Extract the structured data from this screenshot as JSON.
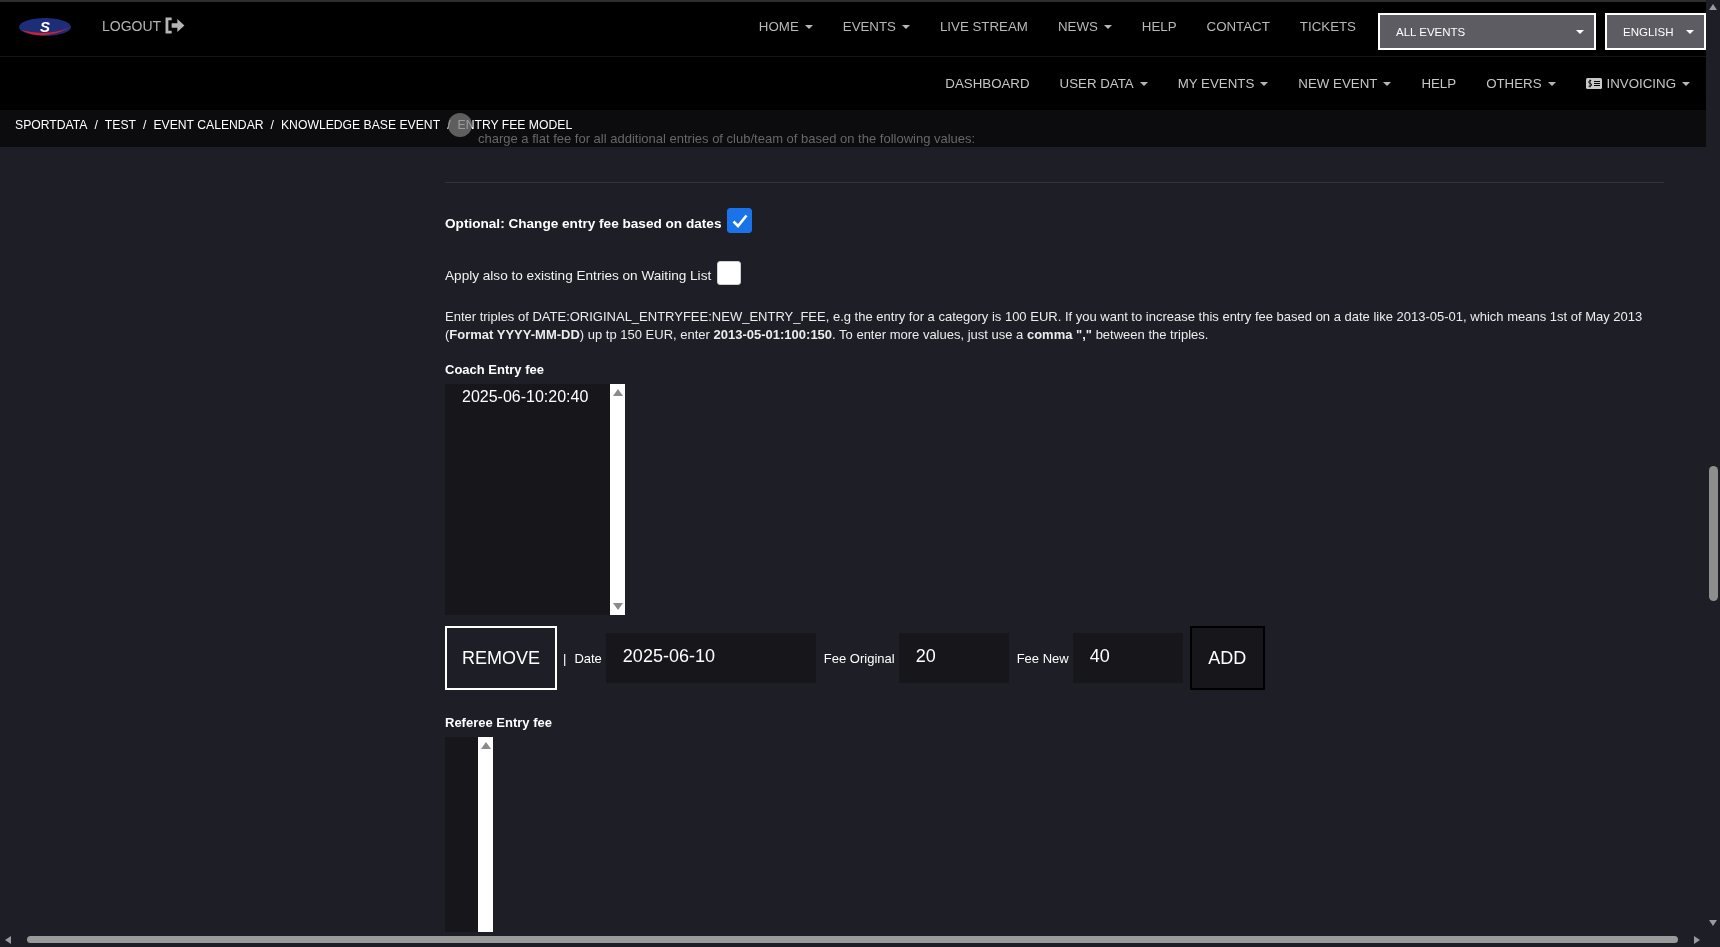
{
  "header": {
    "logo_text": "S",
    "logout": "LOGOUT",
    "main_nav": [
      {
        "label": "HOME",
        "dropdown": true
      },
      {
        "label": "EVENTS",
        "dropdown": true
      },
      {
        "label": "LIVE STREAM",
        "dropdown": false
      },
      {
        "label": "NEWS",
        "dropdown": true
      },
      {
        "label": "HELP",
        "dropdown": false
      },
      {
        "label": "CONTACT",
        "dropdown": false
      },
      {
        "label": "TICKETS",
        "dropdown": false
      }
    ],
    "event_select": {
      "value": "ALL EVENTS"
    },
    "language_select": {
      "value": "ENGLISH"
    }
  },
  "sub_nav": [
    {
      "label": "DASHBOARD",
      "kind": "text",
      "dropdown": false
    },
    {
      "label": "USER DATA",
      "kind": "text",
      "dropdown": true
    },
    {
      "label": "MY EVENTS",
      "kind": "text",
      "dropdown": true
    },
    {
      "label": "NEW EVENT",
      "kind": "text",
      "dropdown": true
    },
    {
      "label": "HELP",
      "kind": "text",
      "dropdown": false
    },
    {
      "label": "OTHERS",
      "kind": "text",
      "dropdown": true
    },
    {
      "label": "INVOICING",
      "kind": "icon_text",
      "dropdown": true
    }
  ],
  "breadcrumb": [
    {
      "label": "SPORTDATA",
      "separator": "/"
    },
    {
      "label": "TEST",
      "separator": "/"
    },
    {
      "label": "EVENT CALENDAR",
      "separator": "/"
    },
    {
      "label": "KNOWLEDGE BASE EVENT",
      "separator": "/"
    },
    {
      "label": "ENTRY FEE MODEL"
    }
  ],
  "hidden_text": "charge a flat fee for all additional entries of club/team of based on the following values:",
  "form": {
    "date_option": {
      "label": "Optional: Change entry fee based on dates",
      "checked": true
    },
    "waiting_list_option": {
      "label": "Apply also to existing Entries on Waiting List",
      "checked": false
    },
    "instructions": "Enter triples of DATE:ORIGINAL_ENTRYFEE:NEW_ENTRY_FEE, e.g the entry for a category is 100 EUR. If you want to increase this entry fee based on a date like 2013-05-01, which means 1st of May 2013 (**Format YYYY-MM-DD**) up tp 150 EUR, enter **2013-05-01:100:150**. To enter more values, just use a **comma \",\"** between the triples.",
    "sections": [
      {
        "title": "Coach Entry fee",
        "kind": "wide",
        "entries": [
          {
            "label": "2025-06-10:20:40",
            "selected": false
          }
        ],
        "editor": {
          "remove_button": {
            "label": "REMOVE",
            "focused": true
          },
          "separator": "|",
          "fields": [
            {
              "label": "Date",
              "kind": "date",
              "value": "2025-06-10"
            },
            {
              "label": "Fee Original",
              "kind": "fee",
              "value": "20"
            },
            {
              "label": "Fee New",
              "kind": "fee",
              "value": "40"
            }
          ],
          "add_button": {
            "label": "ADD",
            "focused": false
          }
        }
      },
      {
        "title": "Referee Entry fee",
        "kind": "narrow"
      }
    ]
  }
}
